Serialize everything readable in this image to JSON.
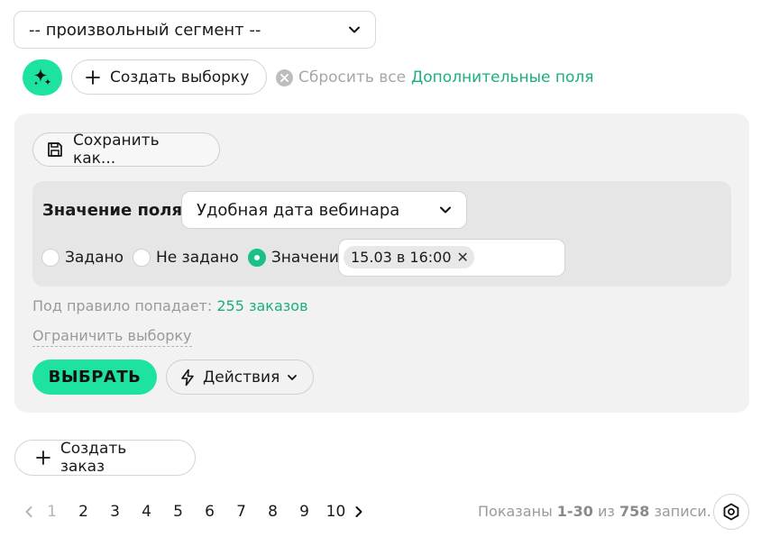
{
  "segment": {
    "value": "-- произвольный сегмент --"
  },
  "toolbar": {
    "create_sample": "Создать выборку",
    "reset_all": "Сбросить все",
    "extra_fields": "Дополнительные поля"
  },
  "rule": {
    "save_as": "Сохранить как...",
    "field_label": "Значение поля",
    "field_value": "Удобная дата вебинара",
    "radios": [
      "Задано",
      "Не задано",
      "Значение"
    ],
    "selected_radio": "Значение",
    "chip": "15.03 в 16:00",
    "chip_remove": "✕",
    "match_prefix": "Под правило попадает:",
    "match_count": "255 заказов",
    "limit": "Ограничить выборку",
    "select": "ВЫБРАТЬ",
    "actions": "Действия"
  },
  "create_order": "Создать заказ",
  "pagination": {
    "pages": [
      "1",
      "2",
      "3",
      "4",
      "5",
      "6",
      "7",
      "8",
      "9",
      "10"
    ],
    "current": "1"
  },
  "records": {
    "prefix": "Показаны",
    "range": "1-30",
    "middle": "из",
    "total": "758",
    "suffix": "записи."
  },
  "colors": {
    "accent": "#1ee3a0",
    "link": "#19b07d",
    "panel": "#f2f2f2"
  },
  "icons": [
    "chevron-down-icon",
    "sparkle-icon",
    "plus-icon",
    "close-circle-icon",
    "floppy-icon",
    "lightning-icon",
    "chevron-left-icon",
    "chevron-right-icon",
    "settings-hex-icon"
  ]
}
